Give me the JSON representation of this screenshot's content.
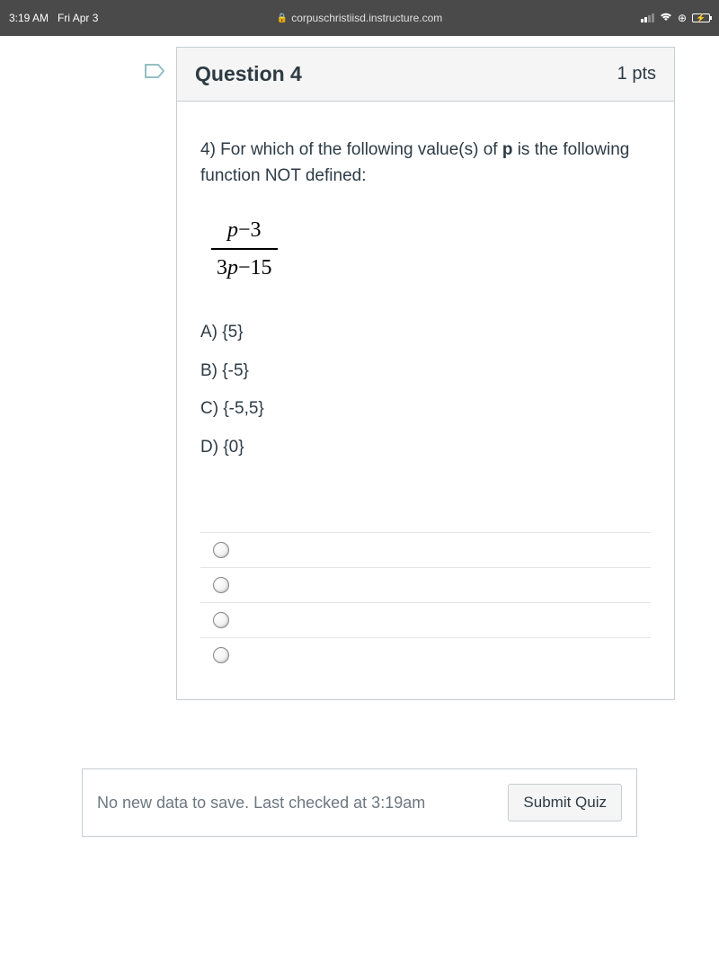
{
  "status": {
    "time": "3:19 AM",
    "date": "Fri Apr 3",
    "url": "corpuschristiisd.instructure.com"
  },
  "question": {
    "title": "Question 4",
    "points": "1 pts",
    "prompt_prefix": "4) For which of the following value(s) of ",
    "prompt_bold": "p",
    "prompt_suffix": " is the following function NOT defined:",
    "fraction": {
      "numerator_var": "p",
      "numerator_rest": "−3",
      "denom_coef": "3",
      "denom_var": "p",
      "denom_rest": "−15"
    },
    "choices": [
      "A) {5}",
      "B) {-5}",
      "C) {-5,5}",
      "D) {0}"
    ]
  },
  "footer": {
    "save_status": "No new data to save. Last checked at 3:19am",
    "submit_label": "Submit Quiz"
  }
}
